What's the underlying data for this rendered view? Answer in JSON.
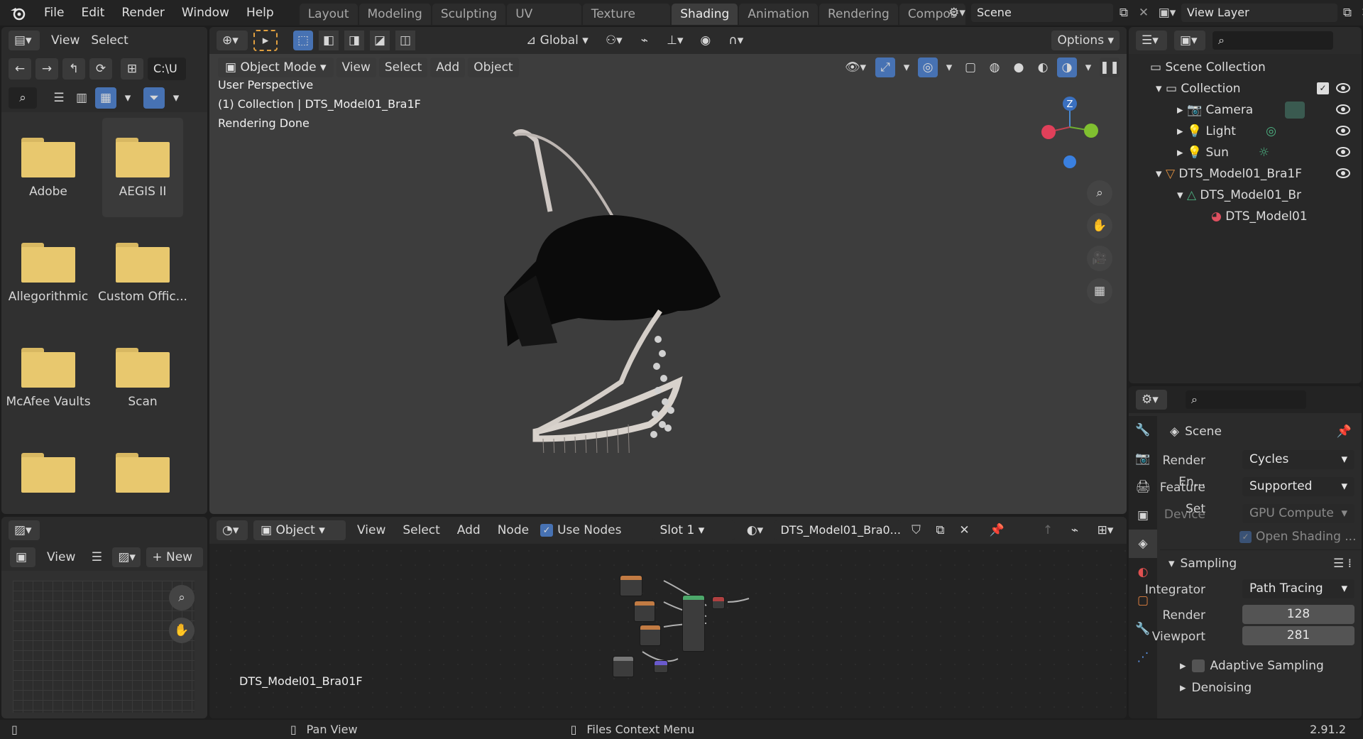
{
  "topbar": {
    "menus": [
      "File",
      "Edit",
      "Render",
      "Window",
      "Help"
    ],
    "workspaces": [
      "Layout",
      "Modeling",
      "Sculpting",
      "UV Editing",
      "Texture Paint",
      "Shading",
      "Animation",
      "Rendering",
      "Compos"
    ],
    "active_workspace": "Shading",
    "scene": "Scene",
    "view_layer": "View Layer"
  },
  "filebrowser": {
    "menus": [
      "View",
      "Select"
    ],
    "path": "C:\\U",
    "items": [
      "Adobe",
      "AEGIS II",
      "Allegorithmic",
      "Custom Offic...",
      "McAfee Vaults",
      "Scan",
      "",
      ""
    ]
  },
  "imageeditor": {
    "view": "View",
    "new": "New"
  },
  "viewport": {
    "mode": "Object Mode",
    "menus": [
      "View",
      "Select",
      "Add",
      "Object"
    ],
    "transform": "Global",
    "options": "Options",
    "info_line1": "User Perspective",
    "info_line2": "(1) Collection | DTS_Model01_Bra1F",
    "info_line3": "Rendering Done",
    "gizmo_z": "Z"
  },
  "nodeeditor": {
    "type": "Object",
    "menus": [
      "View",
      "Select",
      "Add",
      "Node"
    ],
    "use_nodes": "Use Nodes",
    "slot": "Slot 1",
    "material": "DTS_Model01_Bra0...",
    "label": "DTS_Model01_Bra01F"
  },
  "outliner": {
    "rows": [
      {
        "label": "Scene Collection",
        "indent": 0
      },
      {
        "label": "Collection",
        "indent": 1
      },
      {
        "label": "Camera",
        "indent": 2
      },
      {
        "label": "Light",
        "indent": 2
      },
      {
        "label": "Sun",
        "indent": 2
      },
      {
        "label": "DTS_Model01_Bra1F",
        "indent": 1
      },
      {
        "label": "DTS_Model01_Br",
        "indent": 2
      },
      {
        "label": "DTS_Model01",
        "indent": 3
      }
    ]
  },
  "properties": {
    "title": "Scene",
    "render_engine_label": "Render En...",
    "render_engine": "Cycles",
    "feature_set_label": "Feature Set",
    "feature_set": "Supported",
    "device_label": "Device",
    "device": "GPU Compute",
    "open_shading": "Open Shading ...",
    "sampling": "Sampling",
    "integrator_label": "Integrator",
    "integrator": "Path Tracing",
    "render_label": "Render",
    "render_samples": "128",
    "viewport_label": "Viewport",
    "viewport_samples": "281",
    "adaptive": "Adaptive Sampling",
    "denoising": "Denoising"
  },
  "statusbar": {
    "pan": "Pan View",
    "context": "Files Context Menu",
    "version": "2.91.2"
  },
  "colors": {
    "accent": "#4772b3",
    "folder": "#e8c86e",
    "active_tab": "#3d3d3d"
  }
}
